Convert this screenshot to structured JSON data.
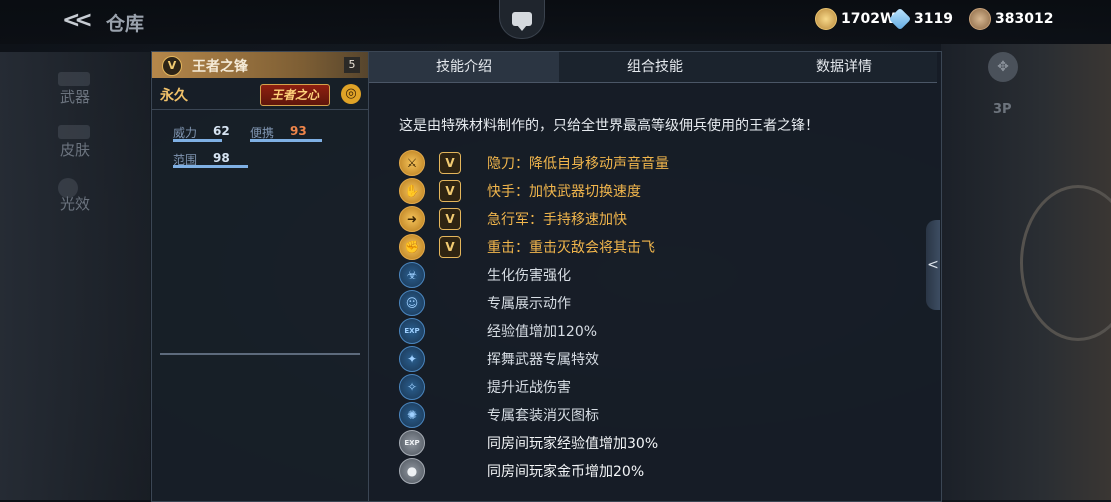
{
  "header": {
    "title": "仓库",
    "currencies": [
      {
        "icon": "gold-coin-icon",
        "value": "1702W"
      },
      {
        "icon": "diamond-icon",
        "value": "3119"
      },
      {
        "icon": "medal-coin-icon",
        "value": "383012"
      }
    ]
  },
  "nav": {
    "items": [
      "武器",
      "皮肤",
      "光效"
    ]
  },
  "weapon": {
    "name": "王者之锋",
    "level": "5",
    "duration": "永久",
    "tag": "王者之心",
    "stats": [
      {
        "label": "威力",
        "value": "62"
      },
      {
        "label": "便携",
        "value": "93"
      },
      {
        "label": "范围",
        "value": "98"
      }
    ]
  },
  "tabs": [
    "技能介绍",
    "组合技能",
    "数据详情"
  ],
  "description": "这是由特殊材料制作的，只给全世界最高等级佣兵使用的王者之锋！",
  "skills": [
    {
      "text": "隐刀：降低自身移动声音音量",
      "icon": "stealth-blade-icon",
      "style": "gold",
      "badge": true
    },
    {
      "text": "快手：加快武器切换速度",
      "icon": "quick-hand-icon",
      "style": "gold",
      "badge": true
    },
    {
      "text": "急行军：手持移速加快",
      "icon": "running-man-icon",
      "style": "gold",
      "badge": true
    },
    {
      "text": "重击：重击灭敌会将其击飞",
      "icon": "heavy-strike-icon",
      "style": "gold",
      "badge": true
    },
    {
      "text": "生化伤害强化",
      "icon": "biohazard-damage-icon",
      "style": "blue",
      "badge": false
    },
    {
      "text": "专属展示动作",
      "icon": "exclusive-pose-icon",
      "style": "blue",
      "badge": false
    },
    {
      "text": "经验值增加120%",
      "icon": "exp-boost-icon",
      "style": "blue",
      "badge": false
    },
    {
      "text": "挥舞武器专属特效",
      "icon": "swing-effect-icon",
      "style": "blue",
      "badge": false
    },
    {
      "text": "提升近战伤害",
      "icon": "melee-damage-icon",
      "style": "blue",
      "badge": false
    },
    {
      "text": "专属套装消灭图标",
      "icon": "kill-mark-icon",
      "style": "blue",
      "badge": false
    },
    {
      "text": "同房间玩家经验值增加30%",
      "icon": "room-exp-icon",
      "style": "gray",
      "badge": false
    },
    {
      "text": "同房间玩家金币增加20%",
      "icon": "room-gold-icon",
      "style": "gray",
      "badge": false
    }
  ],
  "background": {
    "view_label": "3P"
  }
}
